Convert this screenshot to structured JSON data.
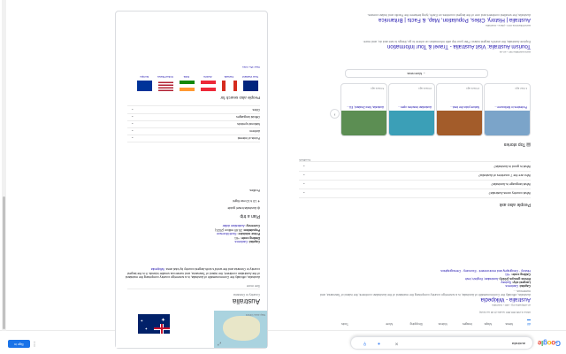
{
  "header": {
    "query": "australia",
    "signin": "Sign in",
    "logo_letters": [
      "G",
      "o",
      "o",
      "g",
      "l",
      "e"
    ]
  },
  "tabs": [
    {
      "label": "All",
      "active": true
    },
    {
      "label": "News",
      "active": false
    },
    {
      "label": "Maps",
      "active": false
    },
    {
      "label": "Images",
      "active": false
    },
    {
      "label": "Videos",
      "active": false
    },
    {
      "label": "Shopping",
      "active": false
    },
    {
      "label": "More",
      "active": false
    },
    {
      "label": "Tools",
      "active": false
    }
  ],
  "stats": "About 2,230,000,000 results (0.46 seconds)",
  "wiki": {
    "url": "en.wikipedia.org › wiki › Australia",
    "title": "Australia - Wikipedia",
    "snippet": "Australia, officially the Commonwealth of Australia, is a sovereign country comprising the mainland of the Australian continent, the island of Tasmania, and numerous ...",
    "facts": [
      {
        "label": "Capital:",
        "value": "Canberra"
      },
      {
        "label": "Largest city:",
        "value": "Sydney"
      },
      {
        "label": "Ethnic groups (2016):",
        "value": "Australian; English; Irish"
      },
      {
        "label": "Calling code:",
        "value": "+61"
      }
    ],
    "links": "History · Geography and environment · Economy · Demographics"
  },
  "paa": {
    "title": "People also ask",
    "questions": [
      "What country owns Australia?",
      "What language is Australia?",
      "Who are the 7 countries of Australia?",
      "What is good in Australia?"
    ],
    "feedback": "Feedback"
  },
  "stories": {
    "title": "Top stories",
    "cards": [
      {
        "title": "Protesters in Melbourne...",
        "source": "BBC",
        "time": "1 hour ago",
        "color": "#7ba4c9"
      },
      {
        "title": "Nature picks the best...",
        "source": "ABC",
        "time": "2 hours ago",
        "color": "#a35c2a"
      },
      {
        "title": "Australian beaches open...",
        "source": "SBS",
        "time": "3 hours ago",
        "color": "#3b9fb7"
      },
      {
        "title": "Australia, New Zealand, EU...",
        "source": "Reuters",
        "time": "5 hours ago",
        "color": "#5c8e53"
      }
    ],
    "more": "More news"
  },
  "travel": {
    "url": "www.australia.com › en-us",
    "title": "Tourism Australia: Visit Australia - Travel & Tour Information",
    "snippet": "Explore Australia, the world's largest island. Plan your trip with information on where to go, things to see and do, and more."
  },
  "britannica": {
    "url": "www.britannica.com › place › Australia",
    "title": "Australia | History, Cities, Population, Map, & Facts | Britannica",
    "snippet": "Australia, the smallest continent and one of the largest countries on Earth, lying between the Pacific and Indian oceans."
  },
  "kp": {
    "title": "Australia",
    "subtitle": "Country in Oceania",
    "see_more": "See more",
    "description": "Australia, officially the Commonwealth of Australia, is a sovereign country comprising the mainland of the Australian continent, the island of Tasmania, and numerous smaller islands. It is the largest country in Oceania and the world's sixth-largest country by total area.",
    "wiki_link": "Wikipedia",
    "facts": [
      {
        "label": "Capital:",
        "value": "Canberra"
      },
      {
        "label": "Dialing code:",
        "value": "+61"
      },
      {
        "label": "Prime minister:",
        "value": "Scott Morrison"
      },
      {
        "label": "Population:",
        "value": "25.69 million (2021)"
      },
      {
        "label": "Currency:",
        "value": "Australian dollar"
      }
    ],
    "plan": "Plan a trip",
    "plan_items": [
      "Australia travel guide",
      "10 h 10 min flight"
    ],
    "profiles": "Profiles",
    "expand_rows": [
      "Points of interest",
      "Anthem",
      "National symbols",
      "Official languages",
      "Cities"
    ],
    "also_search": "People also search for",
    "related": [
      {
        "label": "New Zealand",
        "color": "#00247d"
      },
      {
        "label": "Canada",
        "color": "#d52b1e"
      },
      {
        "label": "Austria",
        "color": "#ed2939"
      },
      {
        "label": "India",
        "color": "#ff9933"
      },
      {
        "label": "United States",
        "color": "#3c3b6e"
      },
      {
        "label": "Europe",
        "color": "#003399"
      }
    ],
    "view_more": "View 15+ more",
    "map_label": "Map data ©2021"
  },
  "colors": {
    "link": "#1a0dab",
    "accent": "#1a73e8",
    "flag_blue": "#012169",
    "flag_red": "#c8102e"
  }
}
